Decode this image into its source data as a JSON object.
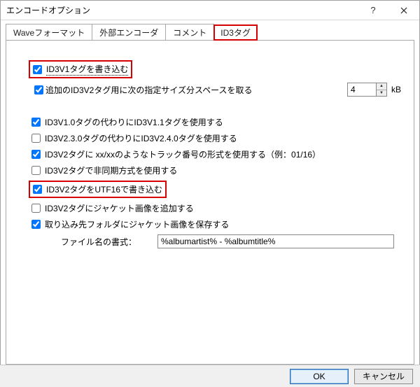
{
  "window": {
    "title": "エンコードオプション"
  },
  "tabs": {
    "t0": "Waveフォーマット",
    "t1": "外部エンコーダ",
    "t2": "コメント",
    "t3": "ID3タグ"
  },
  "options": {
    "write_v1": "ID3V1タグを書き込む",
    "extra_space_label": "追加のID3V2タグ用に次の指定サイズ分スペースを取る",
    "extra_space_value": "4",
    "extra_space_unit": "kB",
    "use_v11": "ID3V1.0タグの代わりにID3V1.1タグを使用する",
    "use_v24": "ID3V2.3.0タグの代わりにID3V2.4.0タグを使用する",
    "track_format": "ID3V2タグに xx/xxのようなトラック番号の形式を使用する（例：01/16）",
    "unsync": "ID3V2タグで非同期方式を使用する",
    "utf16": "ID3V2タグをUTF16で書き込む",
    "add_jacket": "ID3V2タグにジャケット画像を追加する",
    "save_jacket_folder": "取り込み先フォルダにジャケット画像を保存する",
    "filename_format_label": "ファイル名の書式：",
    "filename_format_value": "%albumartist% - %albumtitle%"
  },
  "buttons": {
    "ok": "OK",
    "cancel": "キャンセル"
  }
}
